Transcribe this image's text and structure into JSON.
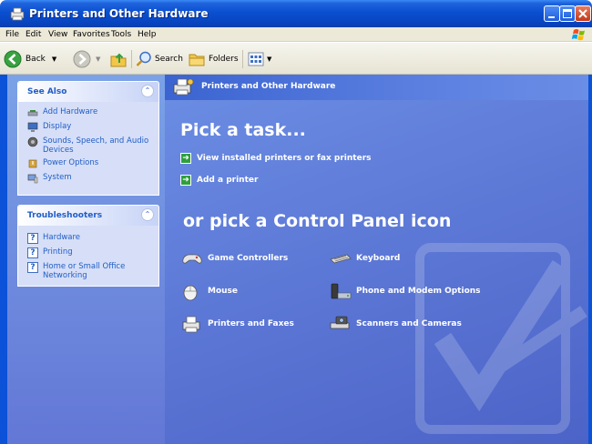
{
  "window": {
    "title": "Printers and Other Hardware"
  },
  "menu": [
    "File",
    "Edit",
    "View",
    "Favorites",
    "Tools",
    "Help"
  ],
  "toolbar": {
    "back_label": "Back",
    "search_label": "Search",
    "folders_label": "Folders"
  },
  "sidebar": {
    "see_also": {
      "title": "See Also",
      "links": [
        "Add Hardware",
        "Display",
        "Sounds, Speech, and Audio Devices",
        "Power Options",
        "System"
      ]
    },
    "troubleshooters": {
      "title": "Troubleshooters",
      "links": [
        "Hardware",
        "Printing",
        "Home or Small Office Networking"
      ]
    }
  },
  "content": {
    "header_title": "Printers and Other Hardware",
    "pick_task": "Pick a task...",
    "tasks": [
      "View installed printers or fax printers",
      "Add a printer"
    ],
    "pick_icon": "or pick a Control Panel icon",
    "icons": [
      "Game Controllers",
      "Keyboard",
      "Mouse",
      "Phone and Modem Options",
      "Printers and Faxes",
      "Scanners and Cameras"
    ]
  }
}
